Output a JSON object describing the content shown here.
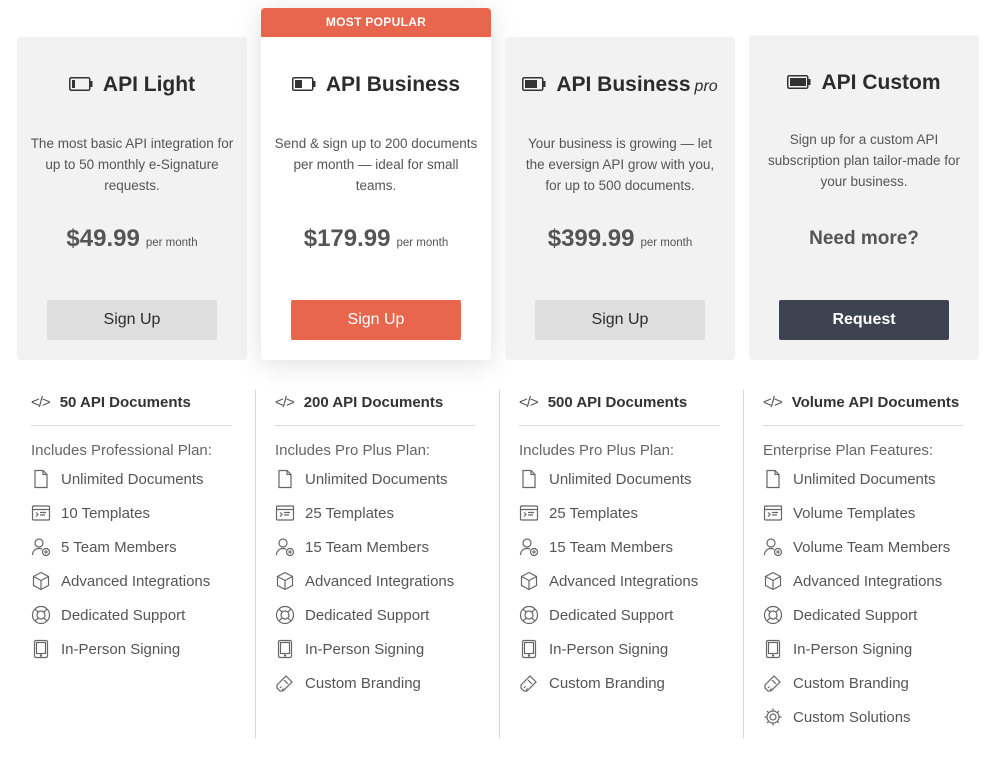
{
  "plans": [
    {
      "title": "API Light",
      "suffix": "",
      "desc": "The most basic API integration for up to 50 monthly e-Signature requests.",
      "price": "$49.99",
      "per": "per month",
      "button": "Sign Up",
      "battery_level": 0.2
    },
    {
      "badge": "MOST POPULAR",
      "title": "API Business",
      "suffix": "",
      "desc": "Send & sign up to 200 documents per month — ideal for small teams.",
      "price": "$179.99",
      "per": "per month",
      "button": "Sign Up",
      "battery_level": 0.45
    },
    {
      "title": "API Business",
      "suffix": "pro",
      "desc": "Your business is growing — let the eversign API grow with you, for up to 500 documents.",
      "price": "$399.99",
      "per": "per month",
      "button": "Sign Up",
      "battery_level": 0.75
    },
    {
      "title": "API Custom",
      "suffix": "",
      "desc": "Sign up for a custom API subscription plan tailor-made for your business.",
      "need_more": "Need more?",
      "button": "Request",
      "battery_level": 1.0
    }
  ],
  "feature_columns": [
    {
      "code_icon": "</>",
      "heading": "50 API Documents",
      "includes": "Includes Professional Plan:",
      "items": [
        {
          "icon": "document-icon",
          "label": "Unlimited Documents"
        },
        {
          "icon": "template-icon",
          "label": "10 Templates"
        },
        {
          "icon": "team-member-icon",
          "label": "5 Team Members"
        },
        {
          "icon": "cube-icon",
          "label": "Advanced Integrations"
        },
        {
          "icon": "lifebuoy-icon",
          "label": "Dedicated Support"
        },
        {
          "icon": "tablet-icon",
          "label": "In-Person Signing"
        }
      ]
    },
    {
      "code_icon": "</>",
      "heading": "200 API Documents",
      "includes": "Includes Pro Plus Plan:",
      "items": [
        {
          "icon": "document-icon",
          "label": "Unlimited Documents"
        },
        {
          "icon": "template-icon",
          "label": "25 Templates"
        },
        {
          "icon": "team-member-icon",
          "label": "15 Team Members"
        },
        {
          "icon": "cube-icon",
          "label": "Advanced Integrations"
        },
        {
          "icon": "lifebuoy-icon",
          "label": "Dedicated Support"
        },
        {
          "icon": "tablet-icon",
          "label": "In-Person Signing"
        },
        {
          "icon": "brush-icon",
          "label": "Custom Branding"
        }
      ]
    },
    {
      "code_icon": "</>",
      "heading": "500 API Documents",
      "includes": "Includes Pro Plus Plan:",
      "items": [
        {
          "icon": "document-icon",
          "label": "Unlimited Documents"
        },
        {
          "icon": "template-icon",
          "label": "25 Templates"
        },
        {
          "icon": "team-member-icon",
          "label": "15 Team Members"
        },
        {
          "icon": "cube-icon",
          "label": "Advanced Integrations"
        },
        {
          "icon": "lifebuoy-icon",
          "label": "Dedicated Support"
        },
        {
          "icon": "tablet-icon",
          "label": "In-Person Signing"
        },
        {
          "icon": "brush-icon",
          "label": "Custom Branding"
        }
      ]
    },
    {
      "code_icon": "</>",
      "heading": "Volume API Documents",
      "includes": "Enterprise Plan Features:",
      "items": [
        {
          "icon": "document-icon",
          "label": "Unlimited Documents"
        },
        {
          "icon": "template-icon",
          "label": "Volume Templates"
        },
        {
          "icon": "team-member-icon",
          "label": "Volume Team Members"
        },
        {
          "icon": "cube-icon",
          "label": "Advanced Integrations"
        },
        {
          "icon": "lifebuoy-icon",
          "label": "Dedicated Support"
        },
        {
          "icon": "tablet-icon",
          "label": "In-Person Signing"
        },
        {
          "icon": "brush-icon",
          "label": "Custom Branding"
        },
        {
          "icon": "gear-icon",
          "label": "Custom Solutions"
        }
      ]
    }
  ],
  "colors": {
    "accent": "#e8654e",
    "dark_button": "#3d4350",
    "card_bg": "#f2f2f2"
  }
}
